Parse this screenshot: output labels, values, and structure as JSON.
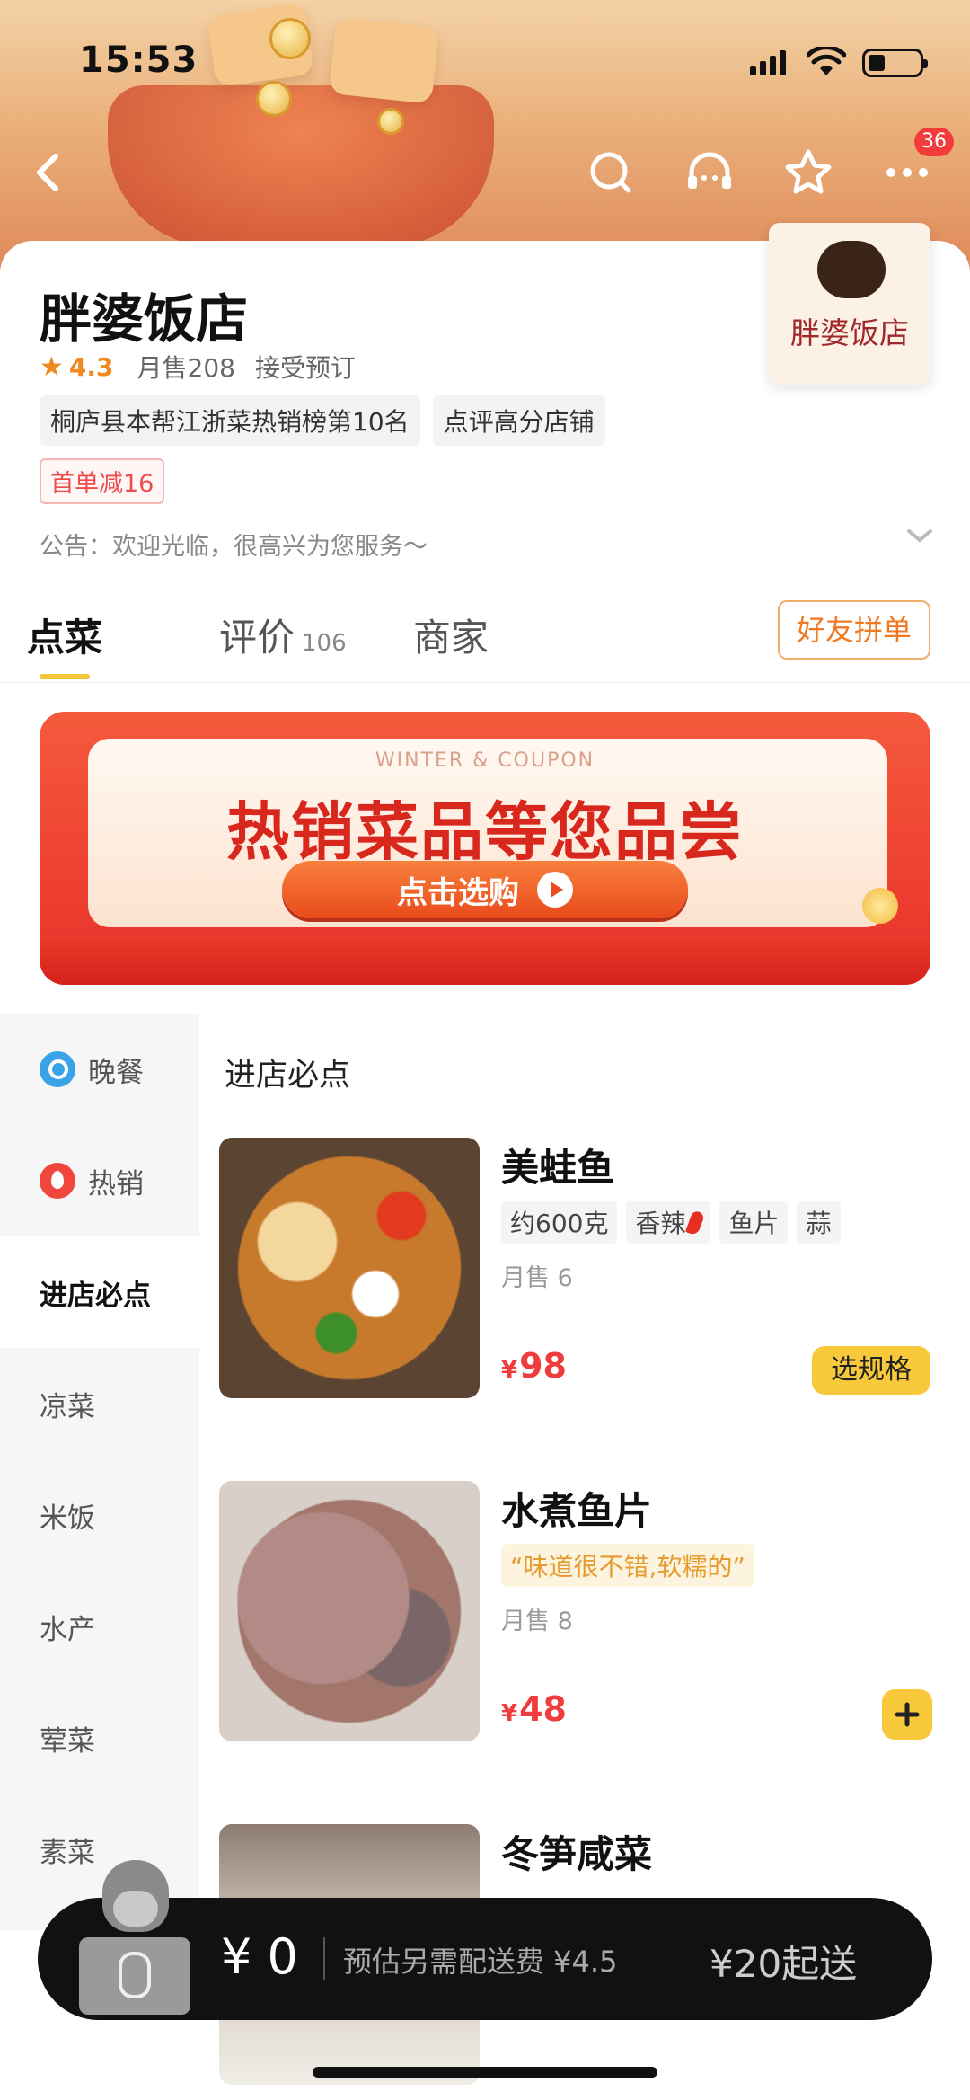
{
  "status_bar": {
    "time": "15:53"
  },
  "header": {
    "notification_count": "36"
  },
  "store": {
    "name": "胖婆饭店",
    "logo_text": "胖婆饭店",
    "rating": "4.3",
    "monthly_sales": "月售208",
    "reservation": "接受预订",
    "tags": [
      "桐庐县本帮江浙菜热销榜第10名",
      "点评高分店铺"
    ],
    "coupon": "首单减16",
    "notice": "公告：欢迎光临，很高兴为您服务～"
  },
  "tabs": {
    "menu": "点菜",
    "reviews": "评价",
    "reviews_count": "106",
    "merchant": "商家",
    "group_order": "好友拼单"
  },
  "promo": {
    "subtitle": "WINTER & COUPON",
    "headline": "热销菜品等您品尝",
    "cta": "点击选购"
  },
  "sidebar": {
    "items": [
      {
        "label": "晚餐",
        "icon": "search-icon"
      },
      {
        "label": "热销",
        "icon": "fire-icon"
      },
      {
        "label": "进店必点"
      },
      {
        "label": "凉菜"
      },
      {
        "label": "米饭"
      },
      {
        "label": "水产"
      },
      {
        "label": "荤菜"
      },
      {
        "label": "素菜"
      }
    ],
    "active_index": 2
  },
  "menu": {
    "section_title": "进店必点",
    "dishes": [
      {
        "name": "美蛙鱼",
        "chips": [
          "约600克",
          "香辣",
          "鱼片",
          "蒜"
        ],
        "sold": "月售 6",
        "currency": "¥",
        "price": "98",
        "action": "选规格"
      },
      {
        "name": "水煮鱼片",
        "quote": "“味道很不错,软糯的”",
        "sold": "月售 8",
        "currency": "¥",
        "price": "48",
        "action": "+"
      },
      {
        "name": "冬笋咸菜"
      }
    ]
  },
  "cart": {
    "total": "¥ 0",
    "delivery_fee": "预估另需配送费 ¥4.5",
    "min_order": "¥20起送"
  },
  "colors": {
    "accent_yellow": "#f9c93c",
    "price_red": "#ef3d3d",
    "rating_orange": "#f0891f",
    "cart_bg": "#111111"
  }
}
